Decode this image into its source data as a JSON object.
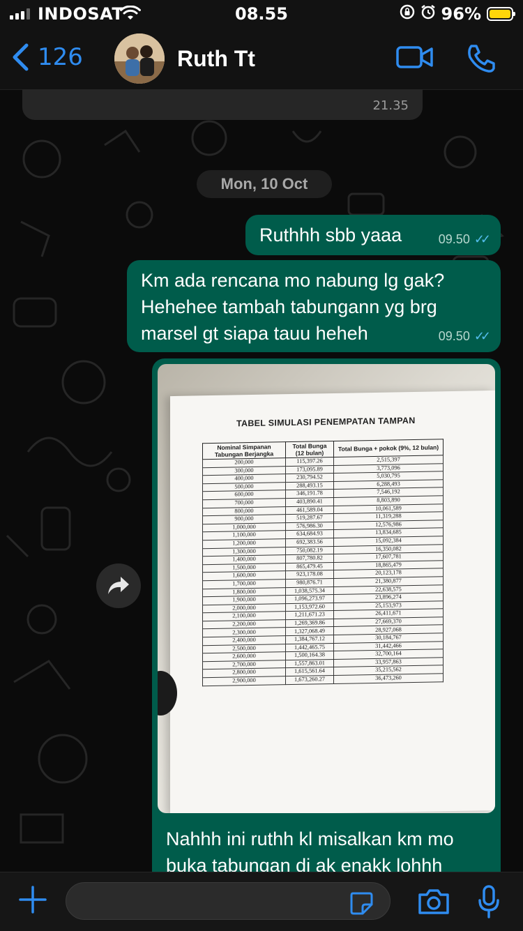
{
  "status_bar": {
    "carrier": "INDOSAT",
    "time": "08.55",
    "battery": "96%",
    "battery_level": 0.96
  },
  "header": {
    "back_count": "126",
    "contact_name": "Ruth Tt"
  },
  "chat": {
    "prev_message_time": "21.35",
    "date_separator": "Mon, 10 Oct",
    "messages": [
      {
        "text": "Ruthhh sbb yaaa",
        "time": "09.50"
      },
      {
        "text": "Km ada rencana mo nabung lg gak? Hehehee tambah tabungann yg brg marsel gt siapa tauu heheh",
        "time": "09.50"
      }
    ],
    "image_message": {
      "doc_title": "TABEL SIMULASI PENEMPATAN TAMPAN",
      "columns": [
        "Nominal Simpanan Tabungan Berjangka",
        "Total Bunga (12 bulan)",
        "Total Bunga + pokok (9%, 12 bulan)"
      ],
      "rows": [
        [
          "200,000",
          "115,397.26",
          "2,515,397"
        ],
        [
          "300,000",
          "173,095.89",
          "3,773,096"
        ],
        [
          "400,000",
          "230,794.52",
          "5,030,795"
        ],
        [
          "500,000",
          "288,493.15",
          "6,288,493"
        ],
        [
          "600,000",
          "346,191.78",
          "7,546,192"
        ],
        [
          "700,000",
          "403,890.41",
          "8,803,890"
        ],
        [
          "800,000",
          "461,589.04",
          "10,061,589"
        ],
        [
          "900,000",
          "519,287.67",
          "11,319,288"
        ],
        [
          "1,000,000",
          "576,986.30",
          "12,576,986"
        ],
        [
          "1,100,000",
          "634,684.93",
          "13,834,685"
        ],
        [
          "1,200,000",
          "692,383.56",
          "15,092,384"
        ],
        [
          "1,300,000",
          "750,082.19",
          "16,350,082"
        ],
        [
          "1,400,000",
          "807,780.82",
          "17,607,781"
        ],
        [
          "1,500,000",
          "865,479.45",
          "18,865,479"
        ],
        [
          "1,600,000",
          "923,178.08",
          "20,123,178"
        ],
        [
          "1,700,000",
          "980,876.71",
          "21,380,877"
        ],
        [
          "1,800,000",
          "1,038,575.34",
          "22,638,575"
        ],
        [
          "1,900,000",
          "1,096,273.97",
          "23,896,274"
        ],
        [
          "2,000,000",
          "1,153,972.60",
          "25,153,973"
        ],
        [
          "2,100,000",
          "1,211,671.23",
          "26,411,671"
        ],
        [
          "2,200,000",
          "1,269,369.86",
          "27,669,370"
        ],
        [
          "2,300,000",
          "1,327,068.49",
          "28,927,068"
        ],
        [
          "2,400,000",
          "1,384,767.12",
          "30,184,767"
        ],
        [
          "2,500,000",
          "1,442,465.75",
          "31,442,466"
        ],
        [
          "2,600,000",
          "1,500,164.38",
          "32,700,164"
        ],
        [
          "2,700,000",
          "1,557,863.01",
          "33,957,863"
        ],
        [
          "2,800,000",
          "1,615,561.64",
          "35,215,562"
        ],
        [
          "2,900,000",
          "1,673,260.27",
          "36,473,260"
        ]
      ],
      "caption": "Nahhh ini ruthh kl misalkan km mo buka tabungan di ak enakk lohhh"
    }
  },
  "icons": {
    "back": "chevron-left-icon",
    "video": "video-call-icon",
    "phone": "phone-icon",
    "forward": "forward-icon",
    "plus": "plus-icon",
    "sticker": "sticker-icon",
    "camera": "camera-icon",
    "mic": "microphone-icon"
  },
  "colors": {
    "accent": "#2f8cf0",
    "outgoing_bubble": "#005c4b",
    "read_ticks": "#53bdeb",
    "battery": "#ffd60a"
  }
}
